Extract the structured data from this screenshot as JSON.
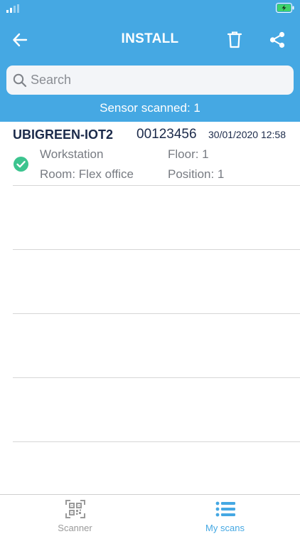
{
  "header": {
    "title": "INSTALL",
    "color": "#45a8e3"
  },
  "search": {
    "placeholder": "Search",
    "value": ""
  },
  "summary": {
    "scanned_label": "Sensor scanned: 1"
  },
  "scans": [
    {
      "name": "UBIGREEN-IOT2",
      "id": "00123456",
      "datetime": "30/01/2020 12:58",
      "status": "check-icon",
      "type": "Workstation",
      "floor": "Floor: 1",
      "room": "Room: Flex office",
      "position": "Position: 1"
    }
  ],
  "bottom_nav": {
    "items": [
      {
        "label": "Scanner",
        "icon": "qr-code-icon",
        "active": false
      },
      {
        "label": "My scans",
        "icon": "list-icon",
        "active": true
      }
    ]
  },
  "colors": {
    "accent": "#45a8e3",
    "success": "#3cc48f",
    "text_dark": "#1b2a4a",
    "text_muted": "#777b82"
  }
}
